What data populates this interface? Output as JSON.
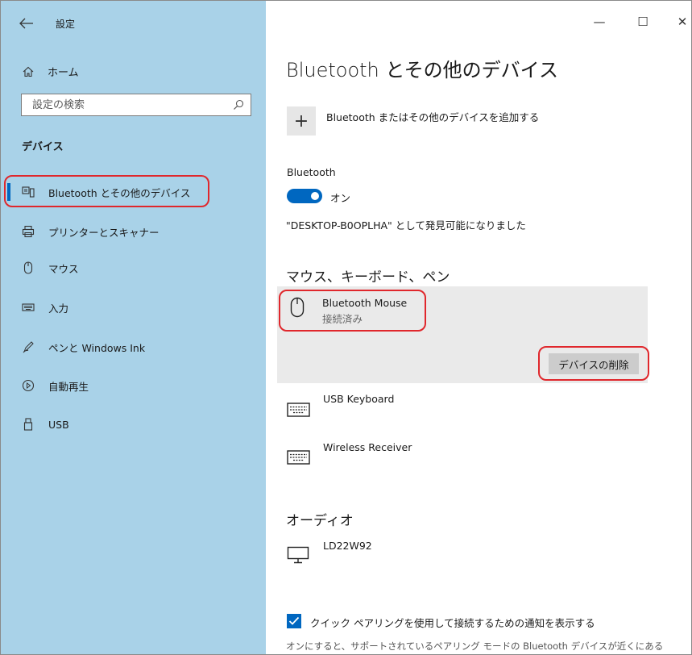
{
  "window": {
    "title": "設定",
    "minimize_glyph": "—",
    "maximize_glyph": "☐",
    "close_glyph": "✕"
  },
  "sidebar": {
    "home_label": "ホーム",
    "search_placeholder": "設定の検索",
    "section_title": "デバイス",
    "items": [
      {
        "label": "Bluetooth とその他のデバイス",
        "icon": "bluetooth-devices-icon",
        "active": true
      },
      {
        "label": "プリンターとスキャナー",
        "icon": "printer-icon"
      },
      {
        "label": "マウス",
        "icon": "mouse-icon"
      },
      {
        "label": "入力",
        "icon": "keyboard-icon"
      },
      {
        "label": "ペンと Windows Ink",
        "icon": "pen-icon"
      },
      {
        "label": "自動再生",
        "icon": "autoplay-icon"
      },
      {
        "label": "USB",
        "icon": "usb-icon"
      }
    ]
  },
  "main": {
    "title": "Bluetooth とその他のデバイス",
    "add_device_label": "Bluetooth またはその他のデバイスを追加する",
    "add_glyph": "+",
    "bluetooth_label": "Bluetooth",
    "bluetooth_state": "オン",
    "discoverable_text": "\"DESKTOP-B0OPLHA\" として発見可能になりました",
    "sections": [
      {
        "heading": "マウス、キーボード、ペン",
        "devices": [
          {
            "name": "Bluetooth Mouse",
            "status": "接続済み",
            "icon": "mouse-icon",
            "selected": true
          },
          {
            "name": "USB Keyboard",
            "icon": "keyboard-icon"
          },
          {
            "name": "Wireless Receiver",
            "icon": "keyboard-icon"
          }
        ]
      },
      {
        "heading": "オーディオ",
        "devices": [
          {
            "name": "LD22W92",
            "icon": "monitor-icon"
          }
        ]
      }
    ],
    "remove_button_label": "デバイスの削除",
    "swift_pair_label": "クイック ペアリングを使用して接続するための通知を表示する",
    "swift_pair_checked": true,
    "swift_pair_description": "オンにすると、サポートされているペアリング モードの Bluetooth デバイスが近くにある"
  },
  "colors": {
    "sidebar_bg": "#a9d2e8",
    "accent": "#0067c0",
    "highlight_ring": "#e0272c",
    "selected_row_bg": "#eaeaea"
  }
}
